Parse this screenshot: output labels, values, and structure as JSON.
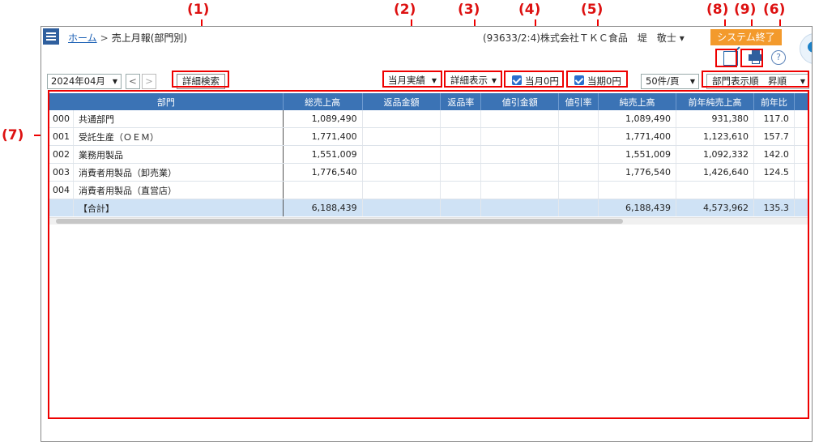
{
  "annotations": [
    "(1)",
    "(2)",
    "(3)",
    "(4)",
    "(5)",
    "(8)",
    "(9)",
    "(6)",
    "(7)"
  ],
  "header": {
    "home": "ホーム",
    "separator": ">",
    "page_title": "売上月報(部門別)",
    "company": "(93633/2:4)株式会社ＴＫＣ食品　堤　敬士 ▾",
    "system_exit": "システム終了"
  },
  "toolbar": {
    "date": "2024年04月",
    "prev": "<",
    "next": ">",
    "detail_search": "詳細検索",
    "period": "当月実績",
    "detail_display": "詳細表示",
    "month_zero": "当月0円",
    "period_zero": "当期0円",
    "per_page": "50件/頁",
    "sort": "部門表示順　昇順",
    "help": "?"
  },
  "table": {
    "headers": [
      "部門",
      "総売上高",
      "返品金額",
      "返品率",
      "値引金額",
      "値引率",
      "純売上高",
      "前年純売上高",
      "前年比"
    ],
    "rows": [
      {
        "code": "000",
        "name": "共通部門",
        "gross": "1,089,490",
        "returns": "",
        "return_rate": "",
        "discount": "",
        "discount_rate": "",
        "net": "1,089,490",
        "prev_net": "931,380",
        "yoy": "117.0"
      },
      {
        "code": "001",
        "name": "受託生産（ＯＥＭ）",
        "gross": "1,771,400",
        "returns": "",
        "return_rate": "",
        "discount": "",
        "discount_rate": "",
        "net": "1,771,400",
        "prev_net": "1,123,610",
        "yoy": "157.7"
      },
      {
        "code": "002",
        "name": "業務用製品",
        "gross": "1,551,009",
        "returns": "",
        "return_rate": "",
        "discount": "",
        "discount_rate": "",
        "net": "1,551,009",
        "prev_net": "1,092,332",
        "yoy": "142.0"
      },
      {
        "code": "003",
        "name": "消費者用製品（卸売業）",
        "gross": "1,776,540",
        "returns": "",
        "return_rate": "",
        "discount": "",
        "discount_rate": "",
        "net": "1,776,540",
        "prev_net": "1,426,640",
        "yoy": "124.5"
      },
      {
        "code": "004",
        "name": "消費者用製品（直営店）",
        "gross": "",
        "returns": "",
        "return_rate": "",
        "discount": "",
        "discount_rate": "",
        "net": "",
        "prev_net": "",
        "yoy": ""
      }
    ],
    "total": {
      "name": "【合計】",
      "gross": "6,188,439",
      "returns": "",
      "return_rate": "",
      "discount": "",
      "discount_rate": "",
      "net": "6,188,439",
      "prev_net": "4,573,962",
      "yoy": "135.3"
    }
  },
  "colors": {
    "header_bg": "#3b73b5",
    "total_row": "#cfe2f5",
    "accent_orange": "#f39a2c",
    "annotation_red": "#e00000"
  }
}
